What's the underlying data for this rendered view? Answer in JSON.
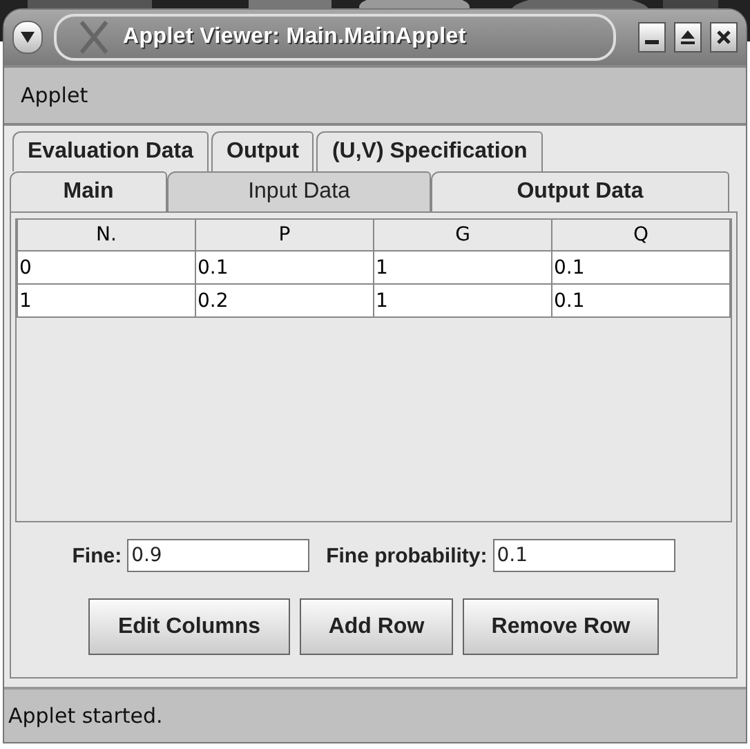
{
  "window": {
    "title": "Applet Viewer: Main.MainApplet"
  },
  "menu_bar": [
    "Applet"
  ],
  "tab_rows": [
    [
      {
        "label": "Evaluation Data",
        "selected": false
      },
      {
        "label": "Output",
        "selected": false
      },
      {
        "label": "(U,V) Specification",
        "selected": false
      }
    ],
    [
      {
        "label": "Main",
        "selected": false
      },
      {
        "label": "Input Data",
        "selected": true
      },
      {
        "label": "Output Data",
        "selected": false
      }
    ]
  ],
  "table": {
    "columns": [
      "N.",
      "P",
      "G",
      "Q"
    ],
    "rows": [
      [
        "0",
        "0.1",
        "1",
        "0.1"
      ],
      [
        "1",
        "0.2",
        "1",
        "0.1"
      ]
    ]
  },
  "fields": [
    {
      "label": "Fine:",
      "value": "0.9"
    },
    {
      "label": "Fine probability:",
      "value": "0.1"
    }
  ],
  "buttons": [
    "Edit Columns",
    "Add Row",
    "Remove Row"
  ],
  "status_bar": "Applet started."
}
